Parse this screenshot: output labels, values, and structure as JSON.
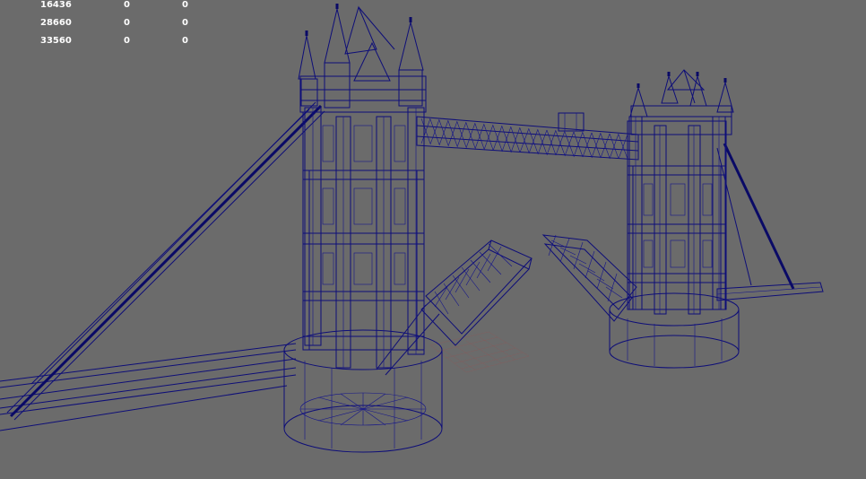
{
  "stats": {
    "rows": [
      {
        "a": "16436",
        "b": "0",
        "c": "0"
      },
      {
        "a": "28660",
        "b": "0",
        "c": "0"
      },
      {
        "a": "33560",
        "b": "0",
        "c": "0"
      }
    ]
  },
  "colors": {
    "background": "#6b6b6b",
    "wireframe": "#0e0e78",
    "grid": "#8a5a5a",
    "hud_text": "#ffffff"
  },
  "scene": {
    "model": "tower-bridge-wireframe",
    "icons": [
      "left-tower",
      "right-tower",
      "walkway",
      "bascule-left",
      "bascule-right",
      "pier-left",
      "pier-right",
      "suspension-cable-left",
      "suspension-cable-right",
      "ground-grid"
    ]
  }
}
